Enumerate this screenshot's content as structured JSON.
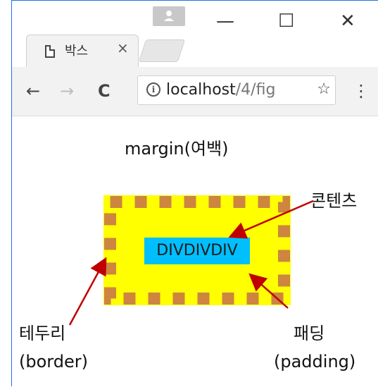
{
  "browser": {
    "tab_title": "박스 ×",
    "tab_title_text": "박스",
    "tab_close": "×",
    "minimize": "—",
    "maximize": "☐",
    "close": "✕",
    "url_host": "localhost",
    "url_path": "/4/fig",
    "back": "←",
    "forward": "→",
    "reload": "C",
    "star": "☆",
    "menu": "⋮",
    "info": "i"
  },
  "diagram": {
    "margin_label": "margin(여백)",
    "content_label": "콘텐츠",
    "content_text": "DIVDIVDIV",
    "border_label_ko": "테두리",
    "border_label_en": "(border)",
    "padding_label_ko": "패딩",
    "padding_label_en": "(padding)"
  },
  "colors": {
    "padding": "#ffff00",
    "content": "#00bfff",
    "border_dash": "#cd853f",
    "arrow": "#c00000"
  }
}
